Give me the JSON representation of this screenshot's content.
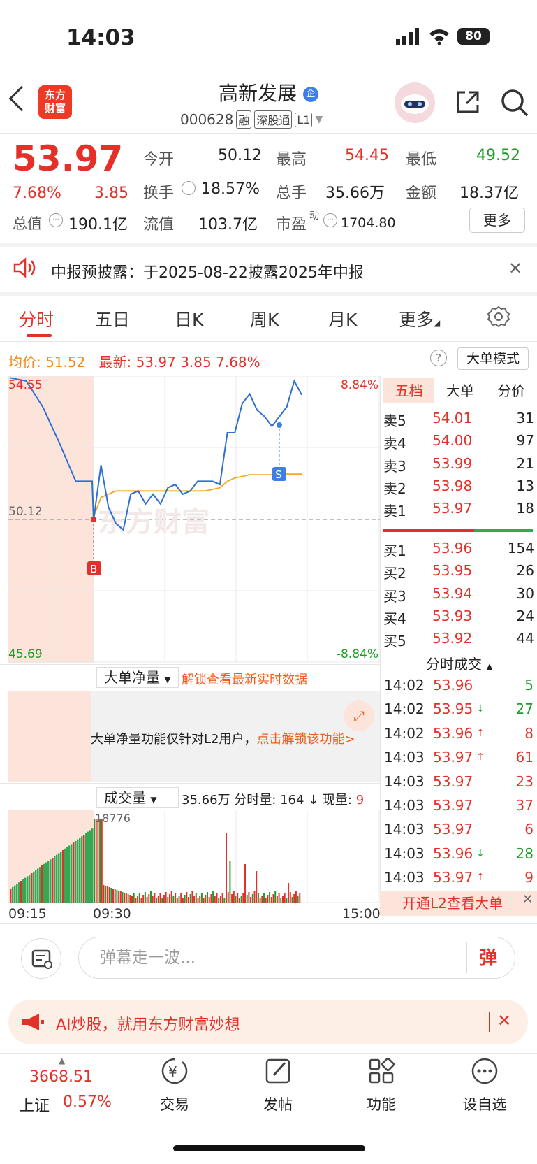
{
  "status_bar": {
    "time": "14:03",
    "battery": "80"
  },
  "header": {
    "logo_text_1": "东方",
    "logo_text_2": "财富",
    "stock_name": "高新发展",
    "badge": "企",
    "code": "000628",
    "tags": [
      "融",
      "深股通",
      "L1"
    ]
  },
  "quote": {
    "price": "53.97",
    "pct": "7.68%",
    "change": "3.85",
    "fields": [
      {
        "label": "今开",
        "value": "50.12",
        "color": "#222222"
      },
      {
        "label": "最高",
        "value": "54.45",
        "color": "#e5302a"
      },
      {
        "label": "最低",
        "value": "49.52",
        "color": "#1f9d2a"
      },
      {
        "label": "换手",
        "value": "18.57%",
        "color": "#222222"
      },
      {
        "label": "总手",
        "value": "35.66万",
        "color": "#222222"
      },
      {
        "label": "金额",
        "value": "18.37亿",
        "color": "#222222"
      }
    ],
    "total_cap_label": "总值",
    "total_cap": "190.1亿",
    "float_cap_label": "流值",
    "float_cap": "103.7亿",
    "pe_label": "市盈",
    "pe_sup": "动",
    "pe": "1704.80",
    "more_label": "更多"
  },
  "notice": {
    "text": "中报预披露：于2025-08-22披露2025年中报"
  },
  "tabs": [
    "分时",
    "五日",
    "日K",
    "周K",
    "月K",
    "更多"
  ],
  "info_row": {
    "avg_label": "均价:",
    "avg": "51.52",
    "latest_label": "最新:",
    "latest": "53.97",
    "change": "3.85",
    "pct": "7.68%",
    "big_mode": "大单模式"
  },
  "chart_labels": {
    "high": "54.55",
    "open": "50.12",
    "low": "45.69",
    "pct_high": "8.84%",
    "pct_low": "-8.84%",
    "buy_marker": "B",
    "sell_marker": "S",
    "watermark": "东方财富",
    "vol_peak": "18776"
  },
  "chart_data": {
    "type": "line",
    "ylim": [
      45.69,
      54.55
    ],
    "x": [
      "09:15",
      "09:30",
      "15:00"
    ],
    "series": [
      {
        "name": "price",
        "values": [
          54.5,
          54.4,
          53.6,
          52.5,
          51.3,
          51.3,
          50.1,
          51.8,
          50.5,
          50.0,
          49.8,
          50.9,
          51.0,
          50.6,
          50.9,
          50.6,
          51.1,
          51.2,
          50.9,
          51.0,
          51.3,
          51.3,
          51.3,
          51.2,
          52.8,
          52.8,
          53.7,
          54.0,
          53.5,
          53.3,
          53.0,
          53.3,
          53.6,
          54.4,
          53.97
        ]
      },
      {
        "name": "avg",
        "values": [
          null,
          null,
          null,
          null,
          null,
          null,
          50.2,
          50.8,
          50.9,
          51.0,
          51.0,
          51.0,
          51.0,
          51.0,
          51.0,
          51.0,
          51.0,
          51.0,
          51.0,
          51.0,
          51.0,
          51.0,
          51.05,
          51.1,
          51.3,
          51.4,
          51.45,
          51.5,
          51.5,
          51.5,
          51.5,
          51.5,
          51.52,
          51.52,
          51.52
        ]
      }
    ]
  },
  "order_book": {
    "tabs": [
      "五档",
      "大单",
      "分价"
    ],
    "asks": [
      {
        "label": "卖5",
        "price": "54.01",
        "vol": "31"
      },
      {
        "label": "卖4",
        "price": "54.00",
        "vol": "97"
      },
      {
        "label": "卖3",
        "price": "53.99",
        "vol": "21"
      },
      {
        "label": "卖2",
        "price": "53.98",
        "vol": "13"
      },
      {
        "label": "卖1",
        "price": "53.97",
        "vol": "18"
      }
    ],
    "bids": [
      {
        "label": "买1",
        "price": "53.96",
        "vol": "154"
      },
      {
        "label": "买2",
        "price": "53.95",
        "vol": "26"
      },
      {
        "label": "买3",
        "price": "53.94",
        "vol": "30"
      },
      {
        "label": "买4",
        "price": "53.93",
        "vol": "24"
      },
      {
        "label": "买5",
        "price": "53.92",
        "vol": "44"
      }
    ]
  },
  "trades": {
    "title": "分时成交",
    "rows": [
      {
        "time": "14:02",
        "price": "53.96",
        "arrow": "",
        "vol": "5",
        "color": "#1f9d2a"
      },
      {
        "time": "14:02",
        "price": "53.95",
        "arrow": "↓",
        "vol": "27",
        "color": "#1f9d2a"
      },
      {
        "time": "14:02",
        "price": "53.96",
        "arrow": "↑",
        "vol": "8",
        "color": "#e5302a"
      },
      {
        "time": "14:03",
        "price": "53.97",
        "arrow": "↑",
        "vol": "61",
        "color": "#e5302a"
      },
      {
        "time": "14:03",
        "price": "53.97",
        "arrow": "",
        "vol": "23",
        "color": "#e5302a"
      },
      {
        "time": "14:03",
        "price": "53.97",
        "arrow": "",
        "vol": "37",
        "color": "#e5302a"
      },
      {
        "time": "14:03",
        "price": "53.97",
        "arrow": "",
        "vol": "6",
        "color": "#e5302a"
      },
      {
        "time": "14:03",
        "price": "53.96",
        "arrow": "↓",
        "vol": "28",
        "color": "#1f9d2a"
      },
      {
        "time": "14:03",
        "price": "53.97",
        "arrow": "↑",
        "vol": "9",
        "color": "#e5302a"
      }
    ],
    "l2_label": "开通L2查看大单"
  },
  "lower": {
    "net_label": "大单净量",
    "unlock_text": "解锁查看最新实时数据",
    "l2_msg_prefix": "大单净量功能仅针对L2用户，",
    "l2_msg_link": "点击解锁该功能>",
    "vol_label": "成交量",
    "vol_info_1": "35.66万 分时量: 164 ↓ 现量: ",
    "vol_info_2": "9",
    "time_start": "09:15",
    "time_open": "09:30",
    "time_end": "15:00"
  },
  "comment": {
    "placeholder": "弹幕走一波...",
    "send": "弹"
  },
  "ai_banner": {
    "text": "AI炒股，就用东方财富妙想"
  },
  "bottom_nav": {
    "index_value": "3668.51",
    "index_name": "上证",
    "index_pct": "0.57%",
    "items": [
      "交易",
      "发帖",
      "功能",
      "设自选"
    ]
  }
}
